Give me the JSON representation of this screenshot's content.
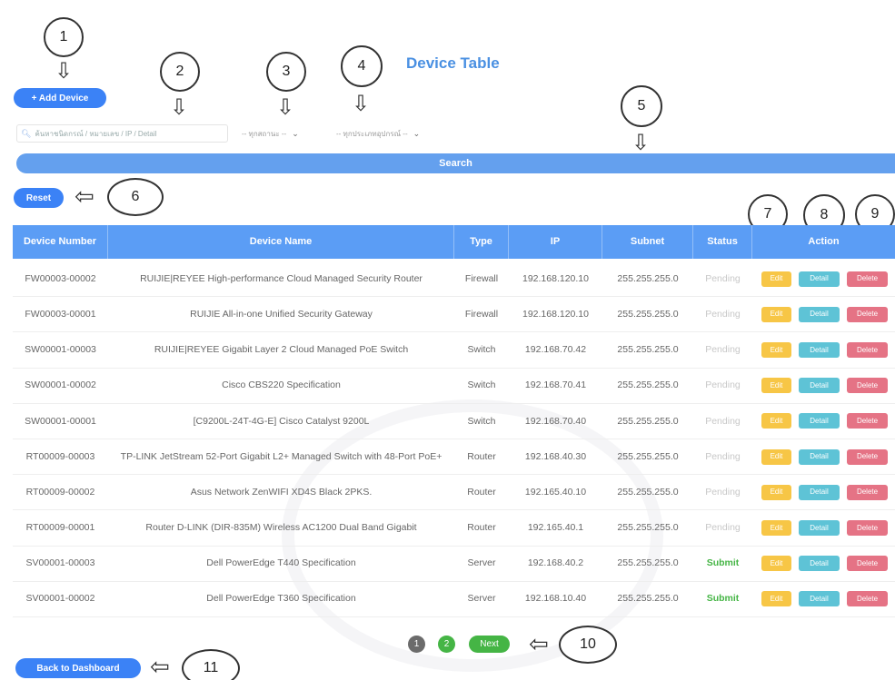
{
  "title": "Device Table",
  "add_device_label": "+ Add Device",
  "search_placeholder": "ค้นหาชนิดกรณ์ / หมายเลข / IP / Detail",
  "status_select": "-- ทุกสถานะ --",
  "type_select": "-- ทุกประเภทอุปกรณ์ --",
  "search_label": "Search",
  "reset_label": "Reset",
  "back_label": "Back to Dashboard",
  "callouts": [
    "1",
    "2",
    "3",
    "4",
    "5",
    "6",
    "7",
    "8",
    "9",
    "10",
    "11"
  ],
  "table": {
    "headers": [
      "Device Number",
      "Device Name",
      "Type",
      "IP",
      "Subnet",
      "Status",
      "Action"
    ],
    "action_labels": {
      "edit": "Edit",
      "detail": "Detail",
      "delete": "Delete"
    },
    "rows": [
      {
        "number": "FW00003-00002",
        "name": "RUIJIE|REYEE High-performance Cloud Managed Security Router",
        "type": "Firewall",
        "ip": "192.168.120.10",
        "subnet": "255.255.255.0",
        "status": "Pending"
      },
      {
        "number": "FW00003-00001",
        "name": "RUIJIE All-in-one Unified Security Gateway",
        "type": "Firewall",
        "ip": "192.168.120.10",
        "subnet": "255.255.255.0",
        "status": "Pending"
      },
      {
        "number": "SW00001-00003",
        "name": "RUIJIE|REYEE Gigabit Layer 2 Cloud Managed PoE Switch",
        "type": "Switch",
        "ip": "192.168.70.42",
        "subnet": "255.255.255.0",
        "status": "Pending"
      },
      {
        "number": "SW00001-00002",
        "name": "Cisco CBS220 Specification",
        "type": "Switch",
        "ip": "192.168.70.41",
        "subnet": "255.255.255.0",
        "status": "Pending"
      },
      {
        "number": "SW00001-00001",
        "name": "[C9200L-24T-4G-E] Cisco Catalyst 9200L",
        "type": "Switch",
        "ip": "192.168.70.40",
        "subnet": "255.255.255.0",
        "status": "Pending"
      },
      {
        "number": "RT00009-00003",
        "name": "TP-LINK JetStream 52-Port Gigabit L2+ Managed Switch with 48-Port PoE+",
        "type": "Router",
        "ip": "192.168.40.30",
        "subnet": "255.255.255.0",
        "status": "Pending"
      },
      {
        "number": "RT00009-00002",
        "name": "Asus Network ZenWIFI XD4S Black 2PKS.",
        "type": "Router",
        "ip": "192.165.40.10",
        "subnet": "255.255.255.0",
        "status": "Pending"
      },
      {
        "number": "RT00009-00001",
        "name": "Router D-LINK (DIR-835M) Wireless AC1200 Dual Band Gigabit",
        "type": "Router",
        "ip": "192.165.40.1",
        "subnet": "255.255.255.0",
        "status": "Pending"
      },
      {
        "number": "SV00001-00003",
        "name": "Dell PowerEdge T440 Specification",
        "type": "Server",
        "ip": "192.168.40.2",
        "subnet": "255.255.255.0",
        "status": "Submit"
      },
      {
        "number": "SV00001-00002",
        "name": "Dell PowerEdge T360 Specification",
        "type": "Server",
        "ip": "192.168.10.40",
        "subnet": "255.255.255.0",
        "status": "Submit"
      }
    ]
  },
  "pagination": {
    "page1": "1",
    "page2": "2",
    "next": "Next"
  },
  "colors": {
    "primary": "#3b82f6",
    "header": "#5b9df5",
    "edit": "#f7c646",
    "detail": "#5ec3d6",
    "delete": "#e57385",
    "submit": "#45b545"
  }
}
